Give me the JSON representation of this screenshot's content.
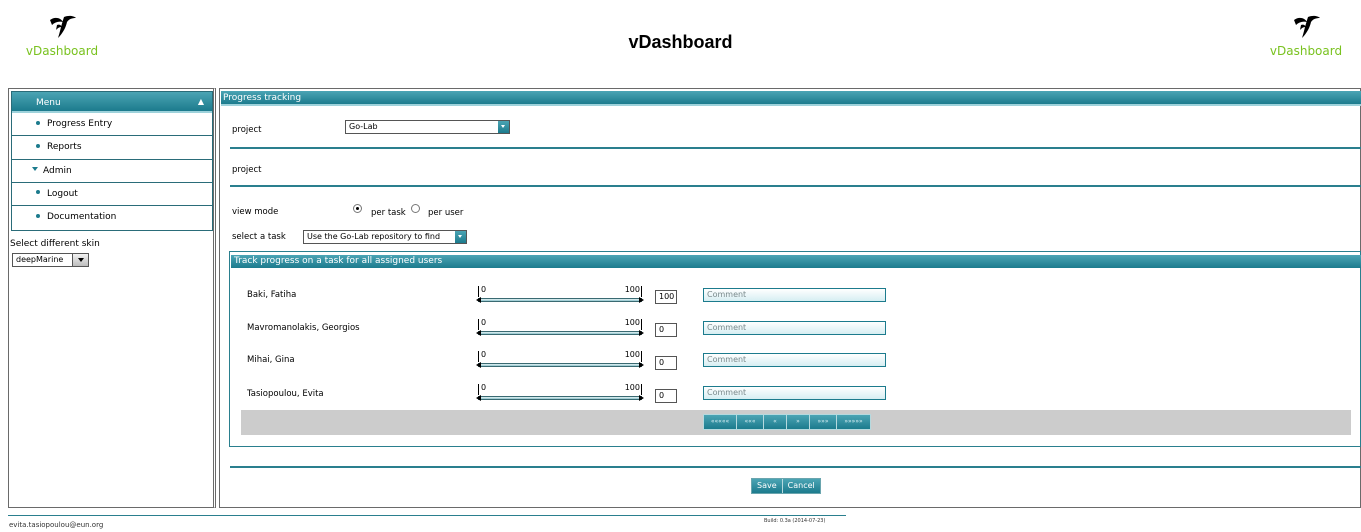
{
  "header": {
    "title": "vDashboard",
    "brand_left": "vDashboard",
    "brand_right": "vDashboard",
    "brand_color": "#79c21f"
  },
  "menu": {
    "title": "Menu",
    "items": [
      {
        "label": "Progress Entry",
        "icon": "bullet"
      },
      {
        "label": "Reports",
        "icon": "bullet"
      },
      {
        "label": "Admin",
        "icon": "triangle-down"
      },
      {
        "label": "Logout",
        "icon": "bullet"
      },
      {
        "label": "Documentation",
        "icon": "bullet"
      }
    ]
  },
  "skin": {
    "label": "Select different skin",
    "value": "deepMarine"
  },
  "panel": {
    "title": "Progress tracking",
    "project_label": "project",
    "project_value": "Go-Lab",
    "project_label2": "project",
    "view_mode_label": "view mode",
    "view_modes": [
      "per task",
      "per user"
    ],
    "view_mode_selected": "per task",
    "task_label": "select a task",
    "task_value": "Use the Go-Lab repository to find"
  },
  "track": {
    "title": "Track progress on a task for all assigned users",
    "slider_min": "0",
    "slider_max": "100",
    "comment_placeholder": "Comment",
    "rows": [
      {
        "name": "Baki, Fatiha",
        "value": "100"
      },
      {
        "name": "Mavromanolakis, Georgios",
        "value": "0"
      },
      {
        "name": "Mihai, Gina",
        "value": "0"
      },
      {
        "name": "Tasiopoulou, Evita",
        "value": "0"
      }
    ]
  },
  "pager": {
    "buttons": [
      "«««««",
      "«««",
      "«",
      "»",
      "»»»",
      "»»»»»"
    ]
  },
  "actions": {
    "save": "Save",
    "cancel": "Cancel"
  },
  "footer": {
    "email": "evita.tasiopoulou@eun.org",
    "build": "Build: 0.3a (2014-07-23)"
  },
  "colors": {
    "accent": "#1c7b8d",
    "accent_light": "#4ba4b4"
  }
}
